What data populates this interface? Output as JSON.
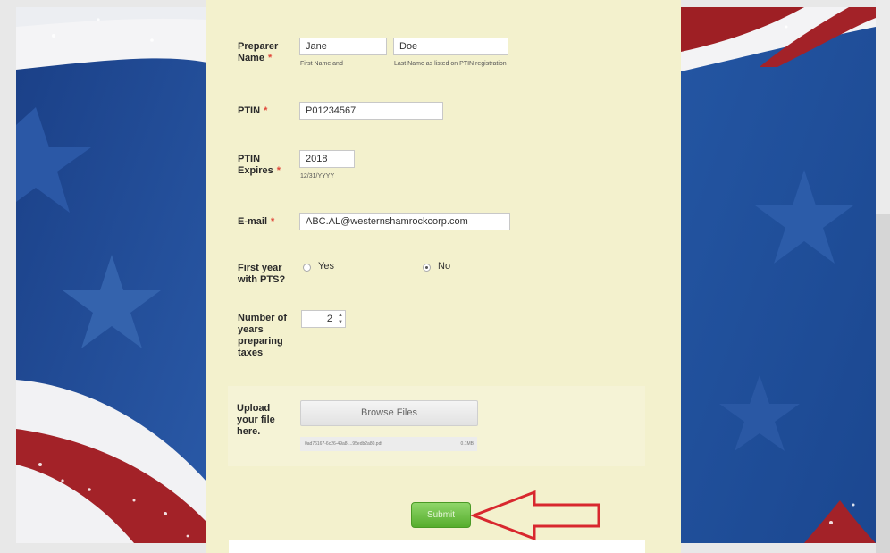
{
  "form": {
    "preparer_name": {
      "label_line1": "Preparer",
      "label_line2": "Name",
      "required": "*",
      "first_value": "Jane",
      "last_value": "Doe",
      "first_hint": "First Name and",
      "last_hint": "Last Name as listed on PTIN registration"
    },
    "ptin": {
      "label": "PTIN",
      "required": "*",
      "value": "P01234567"
    },
    "ptin_expires": {
      "label_line1": "PTIN",
      "label_line2": "Expires",
      "required": "*",
      "value": "2018",
      "hint": "12/31/YYYY"
    },
    "email": {
      "label": "E-mail",
      "required": "*",
      "value": "ABC.AL@westernshamrockcorp.com"
    },
    "first_year": {
      "label_line1": "First year",
      "label_line2": "with PTS?",
      "options": [
        "Yes",
        "No"
      ],
      "selected": "No"
    },
    "years_preparing": {
      "label_lines": [
        "Number of",
        "years",
        "preparing",
        "taxes"
      ],
      "value": "2",
      "arrows": "▲▼"
    },
    "upload": {
      "label_lines": [
        "Upload",
        "your file",
        "here."
      ],
      "button_label": "Browse Files",
      "file_name": "0ad76167-6c26-49a8-...95edb2a80.pdf",
      "file_size": "0.1MB"
    },
    "submit_label": "Submit"
  },
  "colors": {
    "form_background": "#f3f1cd",
    "required_star": "#e0483a",
    "submit_green": "#56ad2c",
    "arrow_red": "#d8282e",
    "flag_blue": "#1f4f98",
    "flag_red": "#9e1f24"
  },
  "icons": [
    "star-icon",
    "radio-icon",
    "stepper-arrows-icon",
    "arrow-annotation-icon"
  ]
}
